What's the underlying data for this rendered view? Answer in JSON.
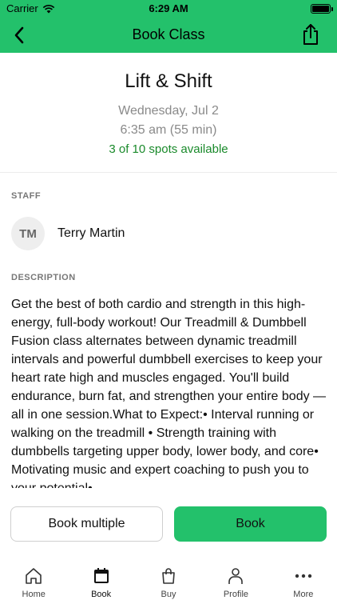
{
  "status_bar": {
    "carrier": "Carrier",
    "time": "6:29 AM"
  },
  "nav": {
    "title": "Book Class"
  },
  "class_info": {
    "name": "Lift & Shift",
    "date": "Wednesday, Jul 2",
    "time": "6:35 am (55 min)",
    "spots": "3 of 10 spots available"
  },
  "staff": {
    "label": "STAFF",
    "initials": "TM",
    "name": "Terry Martin"
  },
  "description": {
    "label": "DESCRIPTION",
    "text": "Get the best of both cardio and strength in this high-energy, full-body workout! Our Treadmill & Dumbbell Fusion class alternates between dynamic treadmill intervals and powerful dumbbell exercises to keep your heart rate high and muscles engaged. You'll build endurance, burn fat, and strengthen your entire body — all in one session.What to Expect:• Interval running or walking on the treadmill • Strength training with dumbbells targeting upper body, lower body, and core• Motivating music and expert coaching to push you to your potential•"
  },
  "actions": {
    "book_multiple": "Book multiple",
    "book": "Book"
  },
  "tabs": [
    {
      "label": "Home",
      "icon": "home-icon"
    },
    {
      "label": "Book",
      "icon": "calendar-icon"
    },
    {
      "label": "Buy",
      "icon": "shopping-bag-icon"
    },
    {
      "label": "Profile",
      "icon": "person-icon"
    },
    {
      "label": "More",
      "icon": "more-dots-icon"
    }
  ],
  "colors": {
    "brand_green": "#23c16b",
    "spots_green": "#1a8a2b",
    "muted_text": "#8a8a8a"
  }
}
